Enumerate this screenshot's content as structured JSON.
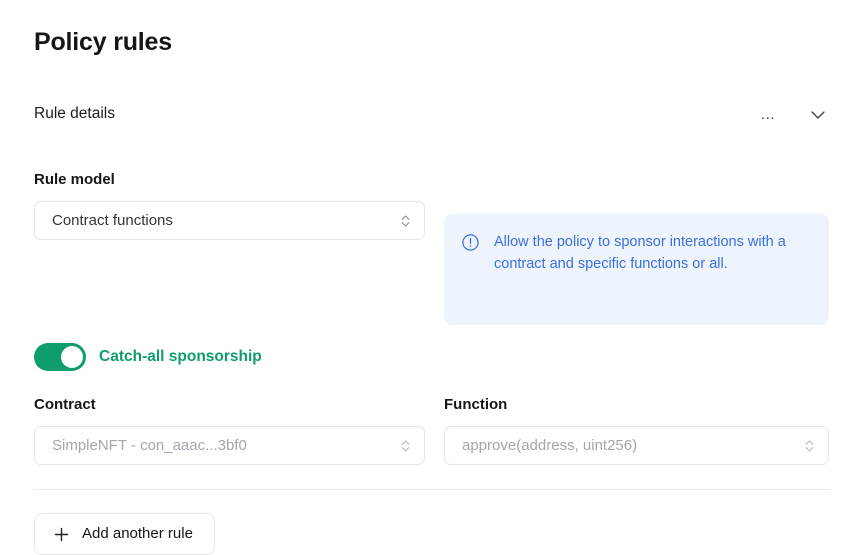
{
  "page": {
    "title": "Policy rules"
  },
  "section": {
    "title": "Rule details",
    "more_label": "…",
    "more_icon": "ellipsis-horizontal-icon",
    "collapse_icon": "chevron-down-icon"
  },
  "rule_model": {
    "label": "Rule model",
    "value": "Contract functions",
    "arrow_icon": "select-chevron-updown-icon"
  },
  "callout": {
    "icon": "exclamation-circle-icon",
    "text": "Allow the policy to sponsor interactions with a contract and specific functions or all.",
    "background_color": "#eef4fc",
    "text_color": "#3b6fe0"
  },
  "catch_all": {
    "label": "Catch-all sponsorship",
    "enabled": true,
    "accent_color": "#0f9d6e"
  },
  "contract": {
    "label": "Contract",
    "value": "SimpleNFT - con_aaac...3bf0",
    "disabled": true,
    "arrow_icon": "select-chevron-updown-icon"
  },
  "function": {
    "label": "Function",
    "value": "approve(address, uint256)",
    "disabled": true,
    "arrow_icon": "select-chevron-updown-icon"
  },
  "add_rule": {
    "label": "Add another rule",
    "icon": "plus-icon"
  }
}
